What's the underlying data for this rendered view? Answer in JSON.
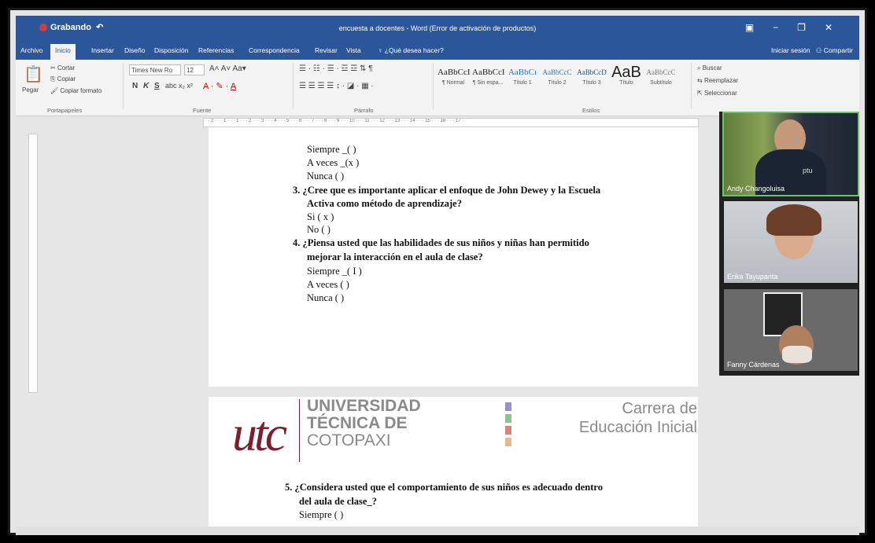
{
  "window": {
    "title": "encuesta a docentes - Word (Error de activación de productos)",
    "qat_label": "Grabando"
  },
  "tabs": [
    "Archivo",
    "Inicio",
    "Insertar",
    "Diseño",
    "Disposición",
    "Referencias",
    "Correspondencia",
    "Revisar",
    "Vista"
  ],
  "tell_me": "¿Qué desea hacer?",
  "account": {
    "signin": "Iniciar sesión",
    "share": "Compartir"
  },
  "ribbon": {
    "clipboard": {
      "cut": "Cortar",
      "copy": "Copiar",
      "paste": "Pegar",
      "format_painter": "Copiar formato",
      "label": "Portapapeles"
    },
    "font": {
      "name": "Times New Ro",
      "size": "12",
      "label": "Fuente",
      "bold": "N",
      "italic": "K",
      "underline": "S"
    },
    "paragraph": {
      "label": "Párrafo"
    },
    "styles": {
      "label": "Estilos",
      "items": [
        {
          "sample": "AaBbCcI",
          "name": "¶ Normal"
        },
        {
          "sample": "AaBbCcI",
          "name": "¶ Sin espa..."
        },
        {
          "sample": "AaBbCı",
          "name": "Título 1"
        },
        {
          "sample": "AaBbCcC",
          "name": "Título 2"
        },
        {
          "sample": "AaBbCcD",
          "name": "Título 3"
        },
        {
          "sample": "AaB",
          "name": "Título"
        },
        {
          "sample": "AaBbCcC",
          "name": "Subtítulo"
        }
      ]
    },
    "editing": {
      "find": "Buscar",
      "replace": "Reemplazar",
      "select": "Seleccionar"
    }
  },
  "document": {
    "page1": {
      "lines": [
        "Siempre _(   )",
        "A veces  _(x  )",
        "Nunca    (   )",
        "3.  ¿Cree que es importante aplicar el enfoque de John Dewey y la Escuela",
        "Activa como método de aprendizaje?",
        "Si          ( x )",
        "No         (   )",
        "4.  ¿Piensa usted que las habilidades  de sus niños y niñas han permitido",
        "mejorar la interacción en el aula de clase?",
        "Siempre _( I )",
        "A veces   (   )",
        "Nunca     (   )"
      ]
    },
    "page2": {
      "header": {
        "logo": "utc",
        "university": [
          "UNIVERSIDAD",
          "TÉCNICA DE",
          "COTOPAXI"
        ],
        "career": [
          "Carrera de",
          "Educación Inicial"
        ]
      },
      "lines": [
        "5.  ¿Considera usted que el comportamiento de sus niños es adecuado dentro",
        "del aula de clase_?",
        "Siempre  (   )"
      ]
    }
  },
  "participants": [
    {
      "name": "Andy Changoluisa",
      "shirt_text": "ptu"
    },
    {
      "name": "Erika Tayupanta"
    },
    {
      "name": "Fanny Cárdenas"
    }
  ],
  "colors": {
    "word_blue": "#2b579a",
    "utc_maroon": "#7a1f2b",
    "active_speaker": "#6ec46e"
  }
}
